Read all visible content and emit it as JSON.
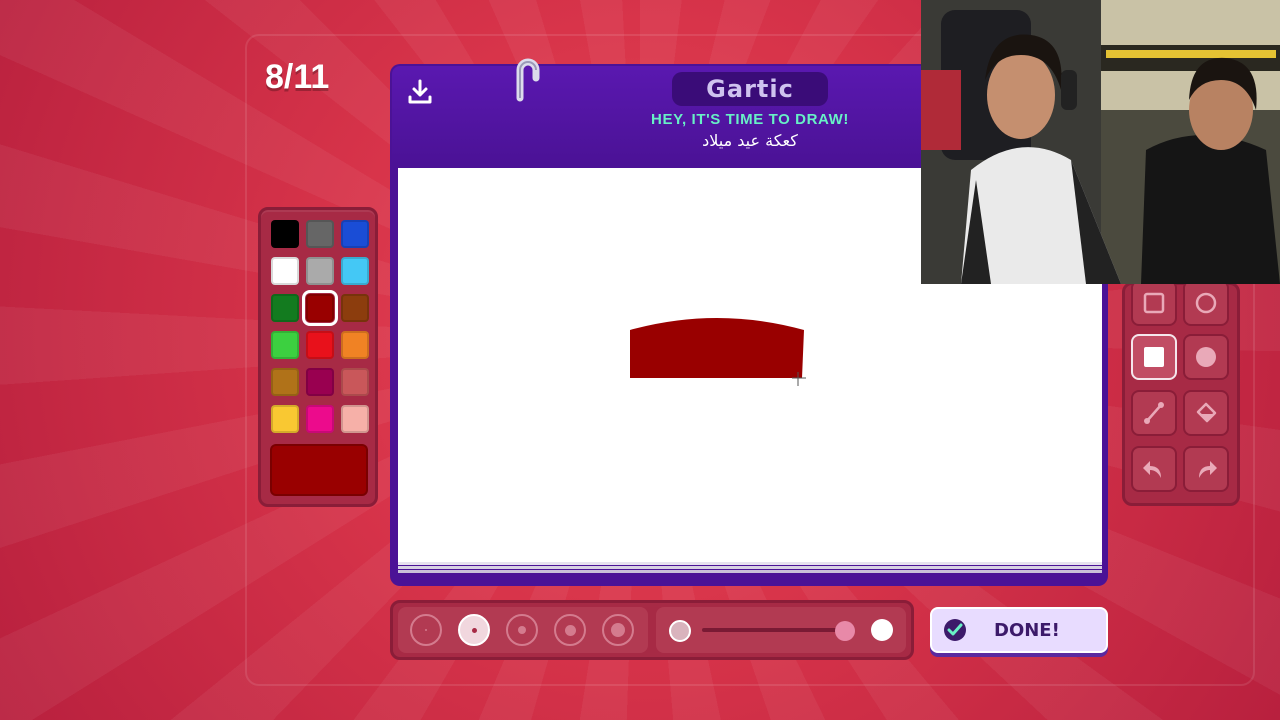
{
  "round": {
    "current": "8/11"
  },
  "header": {
    "logo": "Gartic",
    "prompt": "HEY, IT'S TIME TO DRAW!",
    "word": "كعكة عيد ميلاد"
  },
  "palette": {
    "colors": [
      "#000000",
      "#666666",
      "#1a4dd6",
      "#ffffff",
      "#aaaaaa",
      "#44c8f5",
      "#137b1f",
      "#990000",
      "#8c3d0d",
      "#3cd040",
      "#e8111b",
      "#f08224",
      "#b07219",
      "#990050",
      "#c9575a",
      "#f9c832",
      "#ec0b8c",
      "#f6b0a8"
    ],
    "selected": "#990000",
    "current": "#990000"
  },
  "tools": {
    "items": [
      "square-outline-icon",
      "circle-outline-icon",
      "square-filled-icon",
      "circle-filled-icon",
      "line-icon",
      "fill-bucket-icon",
      "undo-icon",
      "redo-icon"
    ],
    "selected": "square-filled-icon"
  },
  "brush": {
    "sizes": 5,
    "selected_size": 2,
    "opacity_level": 0.9
  },
  "done_button": {
    "label": "DONE!"
  },
  "colors": {
    "header": "#4b1296",
    "prompt_text": "#68f0c6",
    "drawing": "#990000"
  }
}
